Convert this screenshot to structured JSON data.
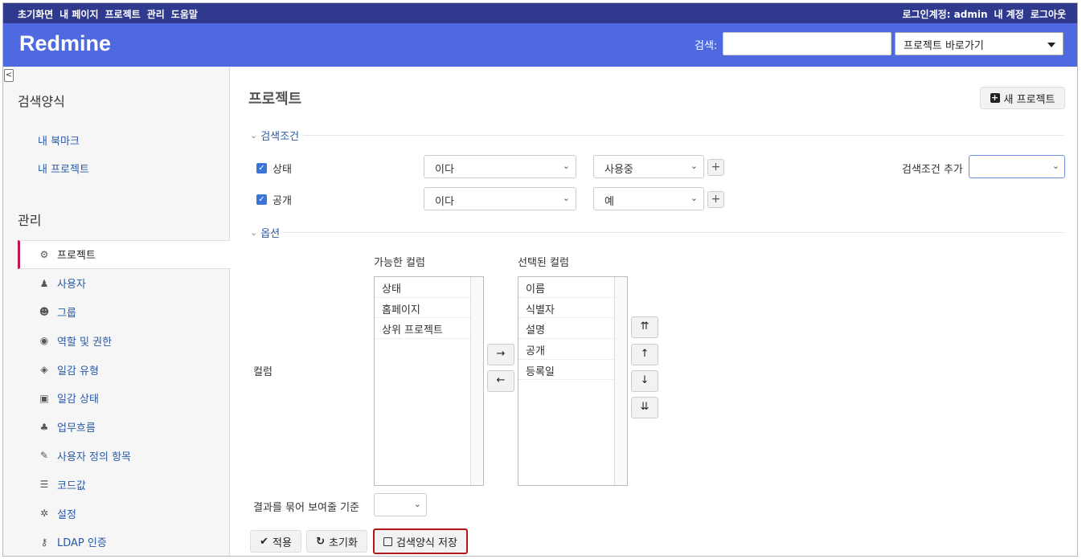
{
  "top_menu": {
    "left": [
      "초기화면",
      "내 페이지",
      "프로젝트",
      "관리",
      "도움말"
    ],
    "logged_in_label": "로그인계정:",
    "logged_in_user": "admin",
    "my_account": "내 계정",
    "logout": "로그아웃"
  },
  "header": {
    "brand": "Redmine",
    "search_label": "검색:",
    "search_value": "",
    "project_jump": "프로젝트 바로가기"
  },
  "sidebar": {
    "collapse_glyph": "<",
    "queries_heading": "검색양식",
    "query_links": [
      "내 북마크",
      "내 프로젝트"
    ],
    "admin_heading": "관리",
    "admin_items": [
      {
        "label": "프로젝트",
        "icon": "projects-icon",
        "glyph": "⚙",
        "selected": true
      },
      {
        "label": "사용자",
        "icon": "user-icon",
        "glyph": "♟"
      },
      {
        "label": "그룹",
        "icon": "group-icon",
        "glyph": "☻"
      },
      {
        "label": "역할 및 권한",
        "icon": "eye-icon",
        "glyph": "◉"
      },
      {
        "label": "일감 유형",
        "icon": "tag-icon",
        "glyph": "◈"
      },
      {
        "label": "일감 상태",
        "icon": "edit-box-icon",
        "glyph": "▣"
      },
      {
        "label": "업무흐름",
        "icon": "workflow-icon",
        "glyph": "♣"
      },
      {
        "label": "사용자 정의 항목",
        "icon": "pencil-icon",
        "glyph": "✎"
      },
      {
        "label": "코드값",
        "icon": "list-icon",
        "glyph": "☰"
      },
      {
        "label": "설정",
        "icon": "settings-icon",
        "glyph": "✲"
      },
      {
        "label": "LDAP 인증",
        "icon": "key-icon",
        "glyph": "⚷"
      }
    ]
  },
  "main": {
    "title": "프로젝트",
    "new_project_button": "새 프로젝트",
    "filters_legend": "검색조건",
    "filters": [
      {
        "label": "상태",
        "checked": true,
        "operator": "이다",
        "value": "사용중"
      },
      {
        "label": "공개",
        "checked": true,
        "operator": "이다",
        "value": "예"
      }
    ],
    "add_filter_label": "검색조건 추가",
    "add_filter_value": "",
    "options_legend": "옵션",
    "columns_label": "컬럼",
    "available_columns_heading": "가능한 컬럼",
    "available_columns": [
      "상태",
      "홈페이지",
      "상위 프로젝트"
    ],
    "selected_columns_heading": "선택된 컬럼",
    "selected_columns": [
      "이름",
      "식별자",
      "설명",
      "공개",
      "등록일"
    ],
    "move_right": "→",
    "move_left": "←",
    "move_top": "⇈",
    "move_up": "↑",
    "move_down": "↓",
    "move_bottom": "⇊",
    "group_by_label": "결과를 묶어 보여줄 기준",
    "group_by_value": "",
    "apply_button": "적용",
    "clear_button": "초기화",
    "save_button": "검색양식 저장"
  },
  "colors": {
    "top_menu_bg": "#2f3a8f",
    "header_bg": "#4f69e0",
    "link": "#2a5aa5",
    "selected_marker": "#c01a4b",
    "save_highlight": "#b0161c"
  }
}
